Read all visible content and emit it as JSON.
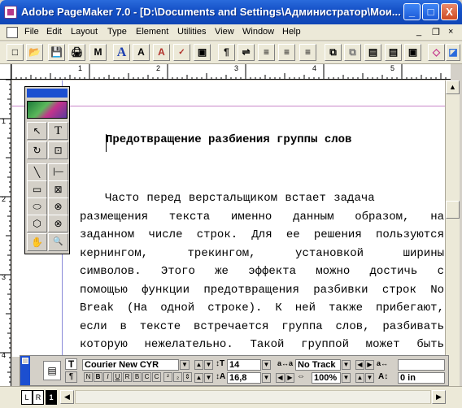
{
  "window": {
    "title": "Adobe PageMaker 7.0 - [D:\\Documents and Settings\\Администратор\\Мои...",
    "min": "_",
    "max": "□",
    "close": "X"
  },
  "menu": [
    "File",
    "Edit",
    "Layout",
    "Type",
    "Element",
    "Utilities",
    "View",
    "Window",
    "Help"
  ],
  "menu_controls": {
    "min": "_",
    "restore": "❐",
    "close": "×"
  },
  "toolbar": [
    "new",
    "open",
    "save",
    "print",
    "find",
    "A",
    "A⁺",
    "A˟",
    "abc",
    "◫",
    "¶",
    "▤",
    "☰",
    "☰",
    "☰",
    "☷",
    "▥",
    "▦",
    "▦",
    "▦",
    "◈",
    "▨"
  ],
  "toolbar_glyphs": [
    "□",
    "📂",
    "💾",
    "🖨",
    "M",
    "A",
    "A",
    "A",
    "✓",
    "▣",
    "¶",
    "⇌",
    "≡",
    "≡",
    "≡",
    "⧉",
    "⧉",
    "▤",
    "▤",
    "▣",
    "◇",
    "◪"
  ],
  "ruler": {
    "h_numbers": [
      "1",
      "2",
      "3",
      "4",
      "5"
    ],
    "v_numbers": [
      "1",
      "2",
      "3",
      "4"
    ]
  },
  "tools": {
    "pointer": "↖",
    "text": "T",
    "rotate": "↻",
    "crop": "⊡",
    "line": "╲",
    "constrained_line": "|—",
    "rect_frame": "▭",
    "rect_frame_x": "⊠",
    "ellipse": "⬭",
    "ellipse_x": "⊗",
    "polygon": "⬡",
    "polygon_x": "⊗",
    "hand": "✋",
    "zoom": "🔍"
  },
  "document": {
    "heading": "Предотвращение разбиения группы слов",
    "lines": [
      "Часто перед верстальщиком встает задача",
      "размещения текста именно данным образом, на",
      "заданном числе строк. Для ее решения пользуются",
      "кернингом, трекингом, установкой ширины",
      "символов. Этого же эффекта можно достичь с",
      "помощью функции предотвращения разбивки строк No",
      "Break (На одной строке). К ней также прибегают,",
      "если в тексте встречается группа слов, разбивать",
      "которую нежелательно. Такой группой может быть"
    ]
  },
  "control": {
    "font": "Courier New CYR",
    "size": "14",
    "leading": "16,8",
    "tracking": "No Track",
    "hscale": "100%",
    "baseline": "0 in",
    "styles": [
      "N",
      "B",
      "I",
      "U",
      "R",
      "B",
      "C",
      "C"
    ]
  },
  "status": {
    "left": "L",
    "right": "R",
    "page": "1"
  }
}
